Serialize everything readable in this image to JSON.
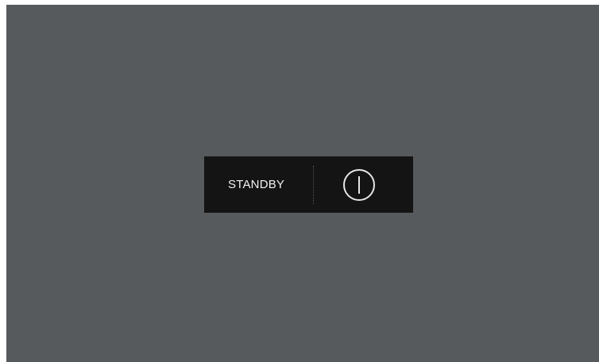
{
  "standby_panel": {
    "label": "STANDBY",
    "power_icon": "power-icon"
  },
  "colors": {
    "screen_background": "#575a5c",
    "panel_background": "#141414",
    "text": "#f2f2f2",
    "icon_stroke": "#e6e6e6"
  }
}
